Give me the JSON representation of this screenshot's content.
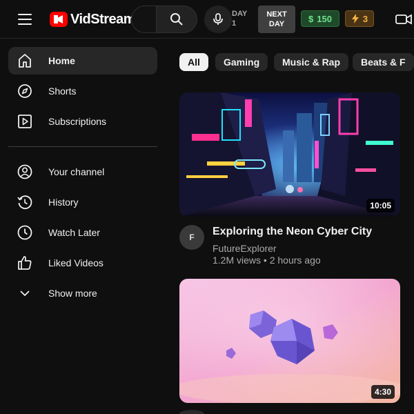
{
  "header": {
    "logo_text": "VidStream",
    "day_label": "DAY",
    "day_value": "1",
    "next_day_line1": "NEXT",
    "next_day_line2": "DAY",
    "money_symbol": "$",
    "money_value": "150",
    "energy_value": "3",
    "icons": [
      "menu-icon",
      "logo-play-icon",
      "search-icon",
      "mic-icon",
      "lightning-icon",
      "video-camera-icon"
    ]
  },
  "sidebar": {
    "items": [
      {
        "label": "Home",
        "icon": "home-icon",
        "active": true
      },
      {
        "label": "Shorts",
        "icon": "compass-icon"
      },
      {
        "label": "Subscriptions",
        "icon": "subscriptions-icon"
      },
      {
        "label": "Your channel",
        "icon": "user-circle-icon"
      },
      {
        "label": "History",
        "icon": "history-icon"
      },
      {
        "label": "Watch Later",
        "icon": "clock-icon"
      },
      {
        "label": "Liked Videos",
        "icon": "thumbs-up-icon"
      },
      {
        "label": "Show more",
        "icon": "chevron-down-icon"
      }
    ]
  },
  "chips": [
    {
      "label": "All",
      "active": true
    },
    {
      "label": "Gaming"
    },
    {
      "label": "Music & Rap"
    },
    {
      "label": "Beats & F"
    }
  ],
  "videos": [
    {
      "title": "Exploring the Neon Cyber City",
      "channel": "FutureExplorer",
      "meta": "1.2M views • 2 hours ago",
      "duration": "10:05",
      "avatar_letter": "F"
    },
    {
      "duration": "4:30"
    }
  ],
  "colors": {
    "background": "#0f0f0f",
    "brand_red": "#ff0000",
    "money_green": "#6fe28b",
    "energy_orange": "#f5b240",
    "chip_active": "#f1f1f1"
  }
}
